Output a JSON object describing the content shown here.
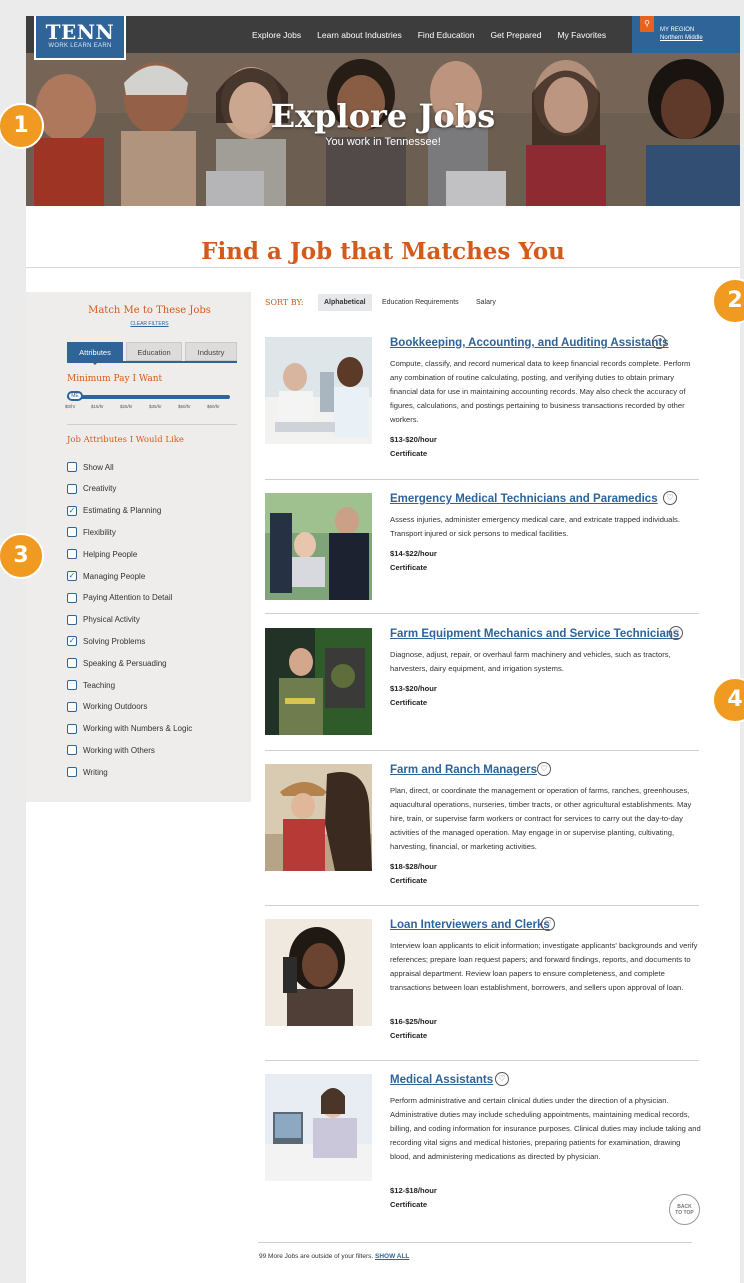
{
  "nav": {
    "logo_main": "TENN",
    "logo_sub": "WORK LEARN EARN",
    "links": [
      "Explore Jobs",
      "Learn about Industries",
      "Find Education",
      "Get Prepared",
      "My Favorites"
    ],
    "region_label": "MY REGION",
    "region_value": "Northern Middle"
  },
  "hero": {
    "title": "Explore Jobs",
    "subtitle": "You work in Tennessee!"
  },
  "section_title": "Find a Job that Matches You",
  "sidebar": {
    "title": "Match Me to These Jobs",
    "clear": "CLEAR FILTERS",
    "tabs": [
      "Attributes",
      "Education",
      "Industry"
    ],
    "active_tab": "Attributes",
    "min_pay_label": "Minimum Pay I Want",
    "slider_knob": "ME",
    "slider_ticks": [
      "$0/hr",
      "$15/hr",
      "$25/hr",
      "$35/hr",
      "$50/hr",
      "$60/hr"
    ],
    "attributes_title": "Job Attributes I Would Like",
    "attributes": [
      {
        "label": "Show All",
        "checked": false
      },
      {
        "label": "Creativity",
        "checked": false
      },
      {
        "label": "Estimating & Planning",
        "checked": true
      },
      {
        "label": "Flexibility",
        "checked": false
      },
      {
        "label": "Helping People",
        "checked": false
      },
      {
        "label": "Managing People",
        "checked": true
      },
      {
        "label": "Paying Attention to Detail",
        "checked": false
      },
      {
        "label": "Physical Activity",
        "checked": false
      },
      {
        "label": "Solving Problems",
        "checked": true
      },
      {
        "label": "Speaking & Persuading",
        "checked": false
      },
      {
        "label": "Teaching",
        "checked": false
      },
      {
        "label": "Working Outdoors",
        "checked": false
      },
      {
        "label": "Working with Numbers & Logic",
        "checked": false
      },
      {
        "label": "Working with Others",
        "checked": false
      },
      {
        "label": "Writing",
        "checked": false
      }
    ]
  },
  "sort": {
    "label": "SORT BY:",
    "options": [
      "Alphabetical",
      "Education Requirements",
      "Salary"
    ],
    "active": "Alphabetical"
  },
  "jobs": [
    {
      "title": "Bookkeeping, Accounting, and Auditing Assistants",
      "description": "Compute, classify, and record numerical data to keep financial records complete. Perform any combination of routine calculating, posting, and verifying duties to obtain primary financial data for use in maintaining accounting records. May also check the accuracy of figures, calculations, and postings pertaining to business transactions recorded by other workers.",
      "pay": "$13-$20/hour",
      "education": "Certificate"
    },
    {
      "title": "Emergency Medical Technicians and Paramedics",
      "description": "Assess injuries, administer emergency medical care, and extricate trapped individuals. Transport injured or sick persons to medical facilities.",
      "pay": "$14-$22/hour",
      "education": "Certificate"
    },
    {
      "title": "Farm Equipment Mechanics and Service Technicians",
      "description": "Diagnose, adjust, repair, or overhaul farm machinery and vehicles, such as tractors, harvesters, dairy equipment, and irrigation systems.",
      "pay": "$13-$20/hour",
      "education": "Certificate"
    },
    {
      "title": "Farm and Ranch Managers",
      "description": "Plan, direct, or coordinate the management or operation of farms, ranches, greenhouses, aquacultural operations, nurseries, timber tracts, or other agricultural establishments. May hire, train, or supervise farm workers or contract for services to carry out the day-to-day activities of the managed operation. May engage in or supervise planting, cultivating, harvesting, financial, or marketing activities.",
      "pay": "$18-$28/hour",
      "education": "Certificate"
    },
    {
      "title": "Loan Interviewers and Clerks",
      "description": "Interview loan applicants to elicit information; investigate applicants' backgrounds and verify references; prepare loan request papers; and forward findings, reports, and documents to appraisal department. Review loan papers to ensure completeness, and complete transactions between loan establishment, borrowers, and sellers upon approval of loan.",
      "pay": "$16-$25/hour",
      "education": "Certificate"
    },
    {
      "title": "Medical Assistants",
      "description": "Perform administrative and certain clinical duties under the direction of a physician. Administrative duties may include scheduling appointments, maintaining medical records, billing, and coding information for insurance purposes. Clinical duties may include taking and recording vital signs and medical histories, preparing patients for examination, drawing blood, and administering medications as directed by physician.",
      "pay": "$12-$18/hour",
      "education": "Certificate"
    }
  ],
  "back_to_top": [
    "BACK",
    "TO TOP"
  ],
  "footer": {
    "more_text": "99 More Jobs are outside of your filters.",
    "show_all": "SHOW ALL"
  },
  "badges": [
    "1",
    "2",
    "3",
    "4"
  ],
  "colors": {
    "accent": "#d35a1b",
    "brand": "#2f6499",
    "nav": "#3d3d3d",
    "badge": "#f09a21"
  }
}
